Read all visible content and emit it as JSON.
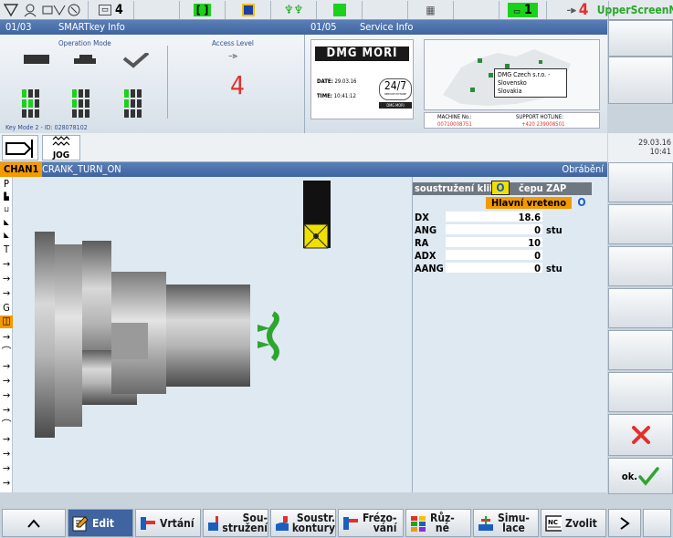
{
  "topbar": {
    "counter_a": "4",
    "counter_b": "1",
    "counter_c": "4",
    "brand": "UpperScreenNG"
  },
  "infobar": {
    "left_page": "01/03",
    "left_title": "SMARTkey Info",
    "right_page": "01/05",
    "right_title": "Service Info"
  },
  "smartkey": {
    "operation_mode": "Operation Mode",
    "access_level": "Access Level",
    "access_value": "4",
    "footer": "Key Mode 2 - ID: 028078102"
  },
  "service": {
    "brand": "DMG MORI",
    "date_label": "DATE:",
    "date_value": "29.03.16",
    "time_label": "TIME:",
    "time_value": "10:41:12",
    "badge": "24/7",
    "badge_sub": "SERVICE HOTLINE",
    "badge_brand": "DMG MORI",
    "map_line1": "DMG Czech s.r.o. -",
    "map_line2": "Slovensko",
    "map_line3": "Slovakia",
    "machine_label": "MACHINE No.:",
    "machine_value": "00710008751",
    "hotline_label": "SUPPORT HOTLINE:",
    "hotline_value": "+420 239008501"
  },
  "modebar": {
    "mode": "JOG",
    "date": "29.03.16",
    "time": "10:41"
  },
  "chanbar": {
    "channel": "CHAN1",
    "program": "CRANK_TURN_ON",
    "operation": "Obrábění"
  },
  "left_symbols": [
    "P",
    "T",
    "G"
  ],
  "params": {
    "title": "soustružení klik",
    "title_suffix": "čepu ZAP",
    "spindle": "Hlavní vreteno",
    "rows": [
      {
        "label": "DX",
        "value": "18.6",
        "unit": ""
      },
      {
        "label": "ANG",
        "value": "0",
        "unit": "stu"
      },
      {
        "label": "RA",
        "value": "10",
        "unit": ""
      },
      {
        "label": "ADX",
        "value": "0",
        "unit": ""
      },
      {
        "label": "AANG",
        "value": "0",
        "unit": "stu"
      }
    ]
  },
  "vsk": {
    "ok_label": "ok."
  },
  "hsk": {
    "edit": "Edit",
    "vrtani": "Vrtání",
    "soustruzeni_1": "Sou-",
    "soustruzeni_2": "stružení",
    "soustr_1": "Soustr.",
    "soustr_2": "kontury",
    "frezo_1": "Frézo-",
    "frezo_2": "vání",
    "ruzne_1": "Růz-",
    "ruzne_2": "né",
    "simu_1": "Simu-",
    "simu_2": "lace",
    "zvolit": "Zvolit"
  },
  "colors": {
    "accent_orange": "#f39a00",
    "header_blue": "#4a6fab",
    "alarm_red": "#e0312b",
    "ok_green": "#2ea52e"
  }
}
